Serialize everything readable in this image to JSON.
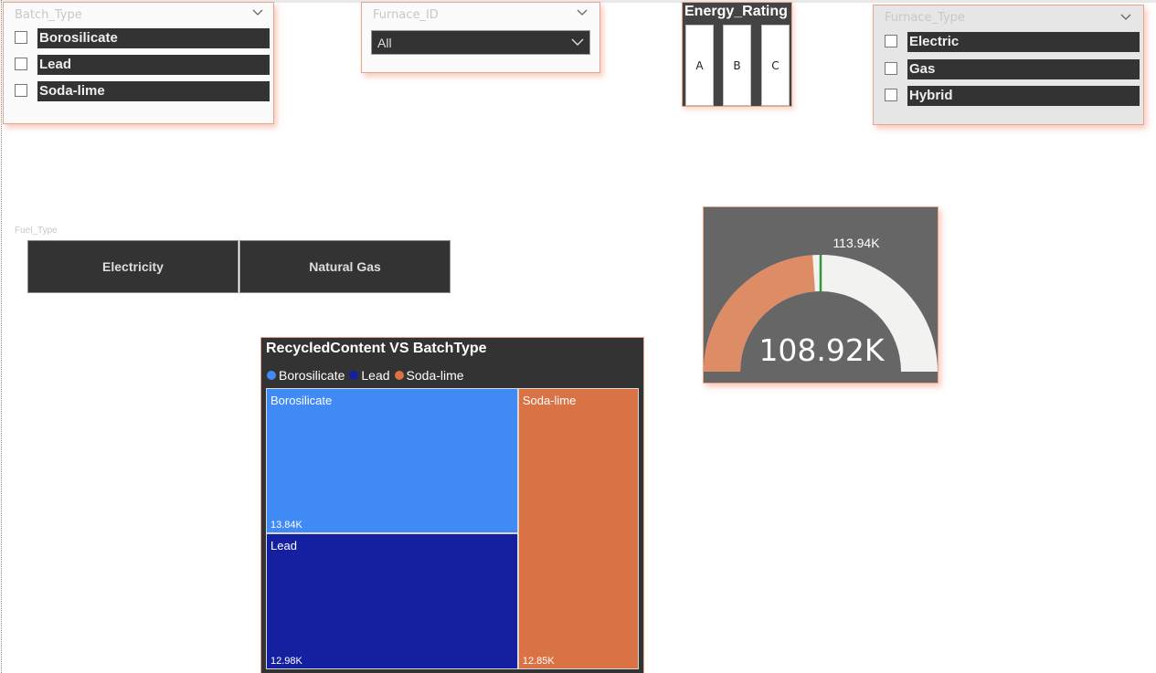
{
  "batch_type": {
    "header": "Batch_Type",
    "items": [
      {
        "label": "Borosilicate"
      },
      {
        "label": "Lead"
      },
      {
        "label": "Soda-lime"
      }
    ]
  },
  "furnace_id": {
    "header": "Furnace_ID",
    "selected": "All"
  },
  "energy_rating": {
    "title": "Energy_Rating",
    "items": [
      "A",
      "B",
      "C"
    ]
  },
  "furnace_type": {
    "header": "Furnace_Type",
    "items": [
      {
        "label": "Electric"
      },
      {
        "label": "Gas"
      },
      {
        "label": "Hybrid"
      }
    ]
  },
  "fuel_type": {
    "header": "Fuel_Type",
    "items": [
      "Electricity",
      "Natural Gas"
    ]
  },
  "gauge": {
    "value": 108.92,
    "value_label": "108.92K",
    "target": 113.94,
    "target_label": "113.94K",
    "min": 0,
    "max": 227.88,
    "fill_color": "#dd8c66",
    "track_color": "#f2f2f0",
    "target_color": "#2e9b3a"
  },
  "chart_data": {
    "type": "treemap",
    "title": "RecycledContent VS BatchType",
    "legend": "top-left",
    "series": [
      {
        "name": "Borosilicate",
        "value": 13.84,
        "value_label": "13.84K",
        "color": "#3f8af5"
      },
      {
        "name": "Lead",
        "value": 12.98,
        "value_label": "12.98K",
        "color": "#1520a0"
      },
      {
        "name": "Soda-lime",
        "value": 12.85,
        "value_label": "12.85K",
        "color": "#d97245"
      }
    ]
  }
}
